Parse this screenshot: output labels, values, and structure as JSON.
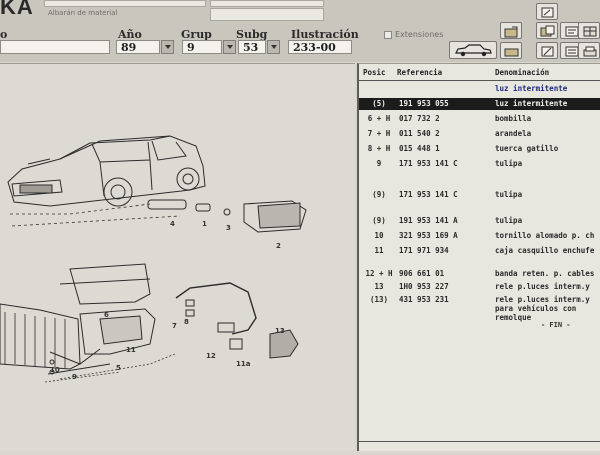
{
  "app": {
    "logo_text": "KA",
    "header_fragment_1": "",
    "header_fragment_2": "Albarán de material"
  },
  "filters": {
    "left_fragment": "o",
    "year_label": "Año",
    "year_value": "89",
    "group_label": "Grup",
    "group_value": "9",
    "subgroup_label": "Subg",
    "subgroup_value": "53",
    "illustration_label": "Ilustración",
    "illustration_value": "233-00",
    "extensions_label": "Extensiones"
  },
  "diagram": {
    "callouts": [
      "4",
      "1",
      "3",
      "2",
      "6",
      "7",
      "8",
      "5",
      "9",
      "10",
      "11",
      "12",
      "11a",
      "13"
    ]
  },
  "parts_table": {
    "headers": {
      "pos": "Posic",
      "ref": "Referencia",
      "den": "Denominación"
    },
    "section_title": "luz intermitente",
    "rows": [
      {
        "pos": "(5)",
        "ref": "191  953  055",
        "den": "luz intermitente"
      },
      {
        "pos": "6  + H",
        "ref": "017  732  2",
        "den": "bombilla"
      },
      {
        "pos": "7  + H",
        "ref": "011  540  2",
        "den": "arandela"
      },
      {
        "pos": "8  + H",
        "ref": "015  448  1",
        "den": "tuerca gatillo"
      },
      {
        "pos": "9",
        "ref": "171  953  141  C",
        "den": "tulipa"
      },
      {
        "pos": "(9)",
        "ref": "171  953  141  C",
        "den": "tulipa"
      },
      {
        "pos": "(9)",
        "ref": "191  953  141  A",
        "den": "tulipa"
      },
      {
        "pos": "10",
        "ref": "321  953  169  A",
        "den": "tornillo alomado p. ch"
      },
      {
        "pos": "11",
        "ref": "171  971  934",
        "den": "caja casquillo enchufe"
      },
      {
        "pos": "12  + H",
        "ref": "906  661  01",
        "den": "banda reten. p. cables"
      },
      {
        "pos": "13",
        "ref": "1H0  953  227",
        "den": "rele p.luces interm.y"
      },
      {
        "pos": "(13)",
        "ref": "431  953  231",
        "den": "rele p.luces interm.y"
      }
    ],
    "extra_line_1": "para vehículos con",
    "extra_line_2": "remolque",
    "end_marker": "- FIN -"
  }
}
